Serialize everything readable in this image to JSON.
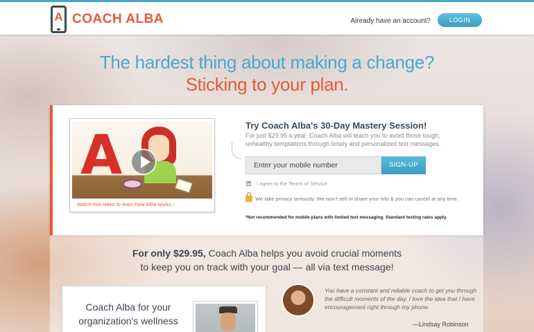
{
  "header": {
    "brand": "COACH ALBA",
    "logo_letter": "A",
    "account_prompt": "Already have an account?",
    "login_label": "LOGIN"
  },
  "hero": {
    "line1": "The hardest thing about making a change?",
    "line2": "Sticking to your plan."
  },
  "signup": {
    "video_link": "Watch this video to learn how Alba works  ›",
    "video_letter": "A",
    "title": "Try Coach Alba's 30-Day Mastery Session!",
    "description": "For just $29.95 a year, Coach Alba will teach you to avoid those tough, unhealthy temptations through timely and personalized text messages.",
    "phone_placeholder": "Enter your mobile number",
    "signup_label": "SIGN-UP",
    "tos_label": "I agree to the Terms of Service",
    "tos_checked": true,
    "privacy": "We take privacy seriously. We won't sell or share your info & you can cancel at any time.",
    "disclaimer": "*Not recommended for mobile plans with limited text messaging. Standard texting rates apply."
  },
  "promo": {
    "price_lead": "For only $29.95,",
    "line1_rest": " Coach Alba helps you avoid crucial moments",
    "line2": "to keep you on track with your goal — all via text message!"
  },
  "organization": {
    "title": "Coach Alba for your organization's wellness program"
  },
  "testimonial": {
    "quote": "You have a constant and reliable coach to get you through the difficult moments of the day. I love the idea that I have encouragement right through my phone.",
    "author": "—Lindsay Robinson"
  },
  "colors": {
    "accent_blue": "#46a9c9",
    "accent_orange": "#e45a36"
  }
}
